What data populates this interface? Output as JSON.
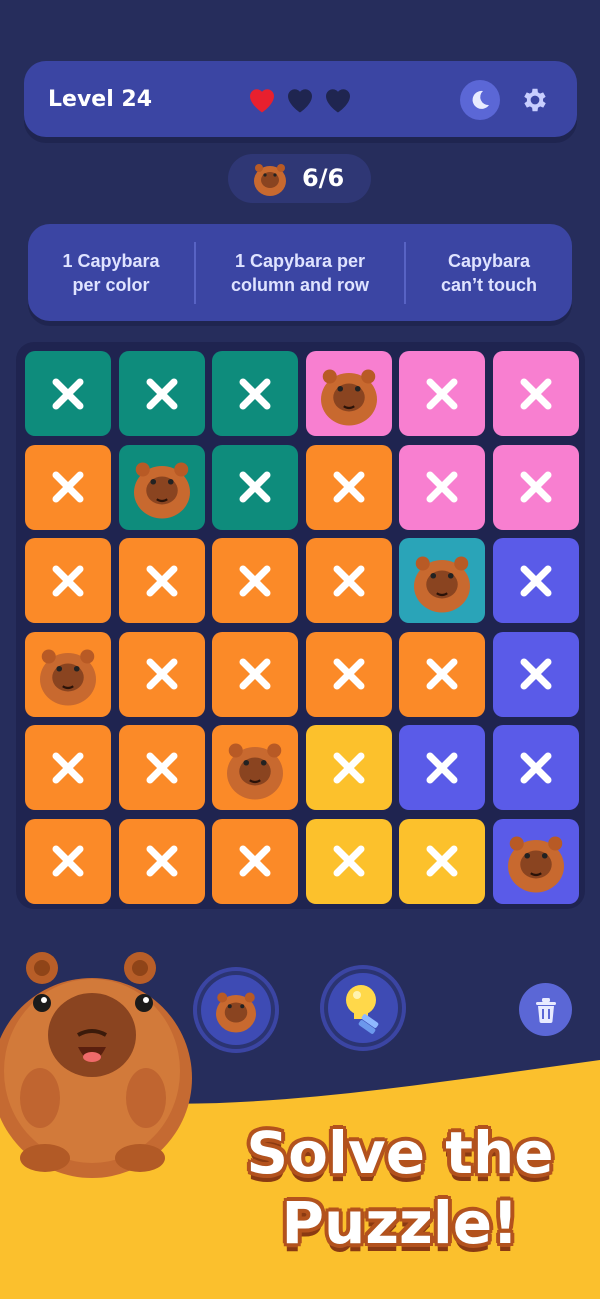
{
  "header": {
    "level_label": "Level 24",
    "lives_total": 3,
    "lives_remaining": 1,
    "theme_icon": "moon-icon",
    "settings_icon": "gear-icon"
  },
  "progress": {
    "icon": "capybara-icon",
    "text": "6/6"
  },
  "rules": [
    "1 Capybara\nper color",
    "1 Capybara per\ncolumn and row",
    "Capybara\ncan’t touch"
  ],
  "colors": {
    "background": "#262d5c",
    "panel": "#3b45a3",
    "teal": "#0e8c7c",
    "pink": "#f87fd0",
    "orange": "#fb8a28",
    "aqua": "#2aa4b8",
    "blue": "#5a5be8",
    "yellow": "#fcc12c",
    "promo_yellow": "#fbc02d"
  },
  "board": {
    "rows": [
      [
        "teal",
        "teal",
        "teal",
        "pink",
        "pink",
        "pink"
      ],
      [
        "orange",
        "teal",
        "teal",
        "orange",
        "pink",
        "pink"
      ],
      [
        "orange",
        "orange",
        "orange",
        "orange",
        "aqua",
        "blue"
      ],
      [
        "orange",
        "orange",
        "orange",
        "orange",
        "orange",
        "blue"
      ],
      [
        "orange",
        "orange",
        "orange",
        "yellow",
        "blue",
        "blue"
      ],
      [
        "orange",
        "orange",
        "orange",
        "yellow",
        "yellow",
        "blue"
      ]
    ],
    "capybaras": [
      [
        0,
        3
      ],
      [
        1,
        1
      ],
      [
        2,
        4
      ],
      [
        3,
        0
      ],
      [
        4,
        2
      ],
      [
        5,
        5
      ]
    ]
  },
  "tools": {
    "place_icon": "capybara-icon",
    "hint_icon": "lightbulb-icon",
    "clear_icon": "trash-icon"
  },
  "promo": {
    "line1": "Solve the",
    "line2": "Puzzle!"
  }
}
